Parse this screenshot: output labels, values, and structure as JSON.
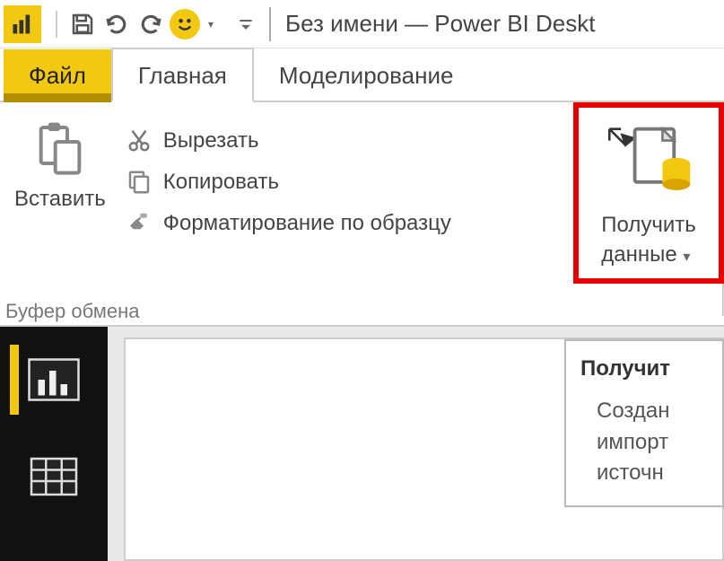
{
  "app": {
    "title": "Без имени — Power BI Deskt"
  },
  "tabs": {
    "file": "Файл",
    "home": "Главная",
    "modeling": "Моделирование"
  },
  "ribbon": {
    "clipboard": {
      "paste": "Вставить",
      "cut": "Вырезать",
      "copy": "Копировать",
      "format_painter": "Форматирование по образцу",
      "group_label": "Буфер обмена"
    },
    "getdata": {
      "line1": "Получить",
      "line2": "данные"
    }
  },
  "tooltip": {
    "title": "Получит",
    "body_l1": "Создан",
    "body_l2": "импорт",
    "body_l3": "источн"
  }
}
